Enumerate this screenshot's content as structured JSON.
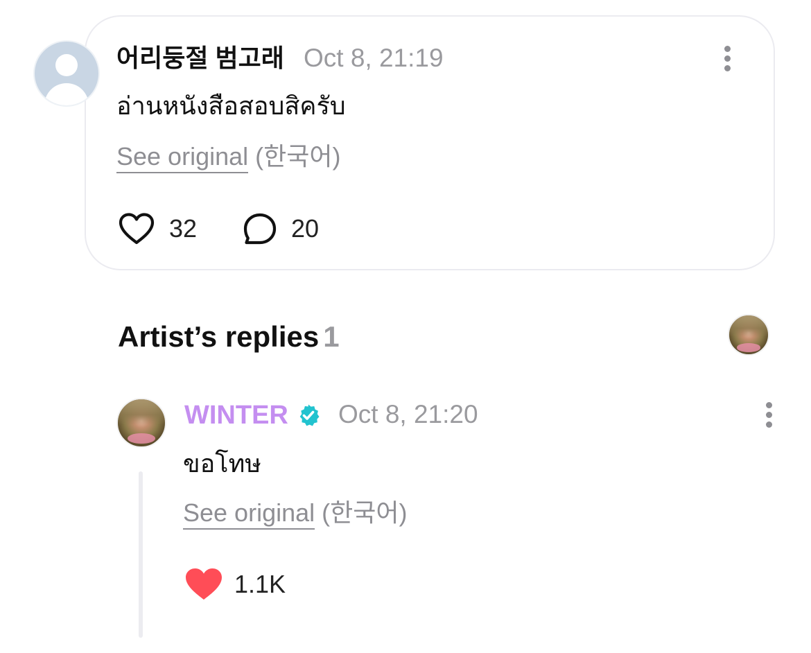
{
  "comment": {
    "author": "어리둥절 범고래",
    "timestamp": "Oct 8, 21:19",
    "text": "อ่านหนังสือสอบสิครับ",
    "see_original": "See original",
    "original_lang": "(한국어)",
    "like_count": "32",
    "reply_count": "20"
  },
  "artist_replies": {
    "title": "Artist’s replies",
    "count": "1",
    "reply": {
      "author": "WINTER",
      "verified": true,
      "timestamp": "Oct 8, 21:20",
      "text": "ขอโทษ",
      "see_original": "See original",
      "original_lang": "(한국어)",
      "like_count": "1.1K",
      "liked": true
    }
  },
  "colors": {
    "artist_name": "#c48ef0",
    "verified_badge": "#22c3cf",
    "liked_heart": "#ff4d57",
    "muted_text": "#9a9a9e",
    "card_border": "#ebebf0"
  },
  "icons": {
    "avatar_default": "person-placeholder-icon",
    "more": "more-vertical-icon",
    "like": "heart-outline-icon",
    "reply": "speech-bubble-icon",
    "liked": "heart-filled-icon",
    "verified": "verified-badge-icon"
  }
}
